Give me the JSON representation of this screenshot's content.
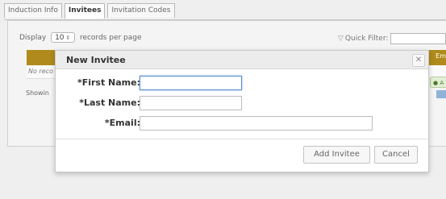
{
  "tabs": [
    {
      "label": "Induction Info"
    },
    {
      "label": "Invitees"
    },
    {
      "label": "Invitation Codes"
    }
  ],
  "list": {
    "display_label": "Display",
    "per_page_value": "10",
    "per_page_suffix": "records per page",
    "quick_filter_label": "Quick Filter:",
    "column_header_right": "Em",
    "no_records_text": "No reco",
    "showing_text": "Showin",
    "green_button_text": "A"
  },
  "dialog": {
    "title": "New Invitee",
    "close_glyph": "✕",
    "fields": [
      {
        "label": "*First Name:",
        "value": ""
      },
      {
        "label": "*Last Name:",
        "value": ""
      },
      {
        "label": "*Email:",
        "value": ""
      }
    ],
    "add_button": "Add Invitee",
    "cancel_button": "Cancel"
  },
  "colors": {
    "header_bar": "#b08a1c",
    "focus": "#5b8fd1"
  }
}
